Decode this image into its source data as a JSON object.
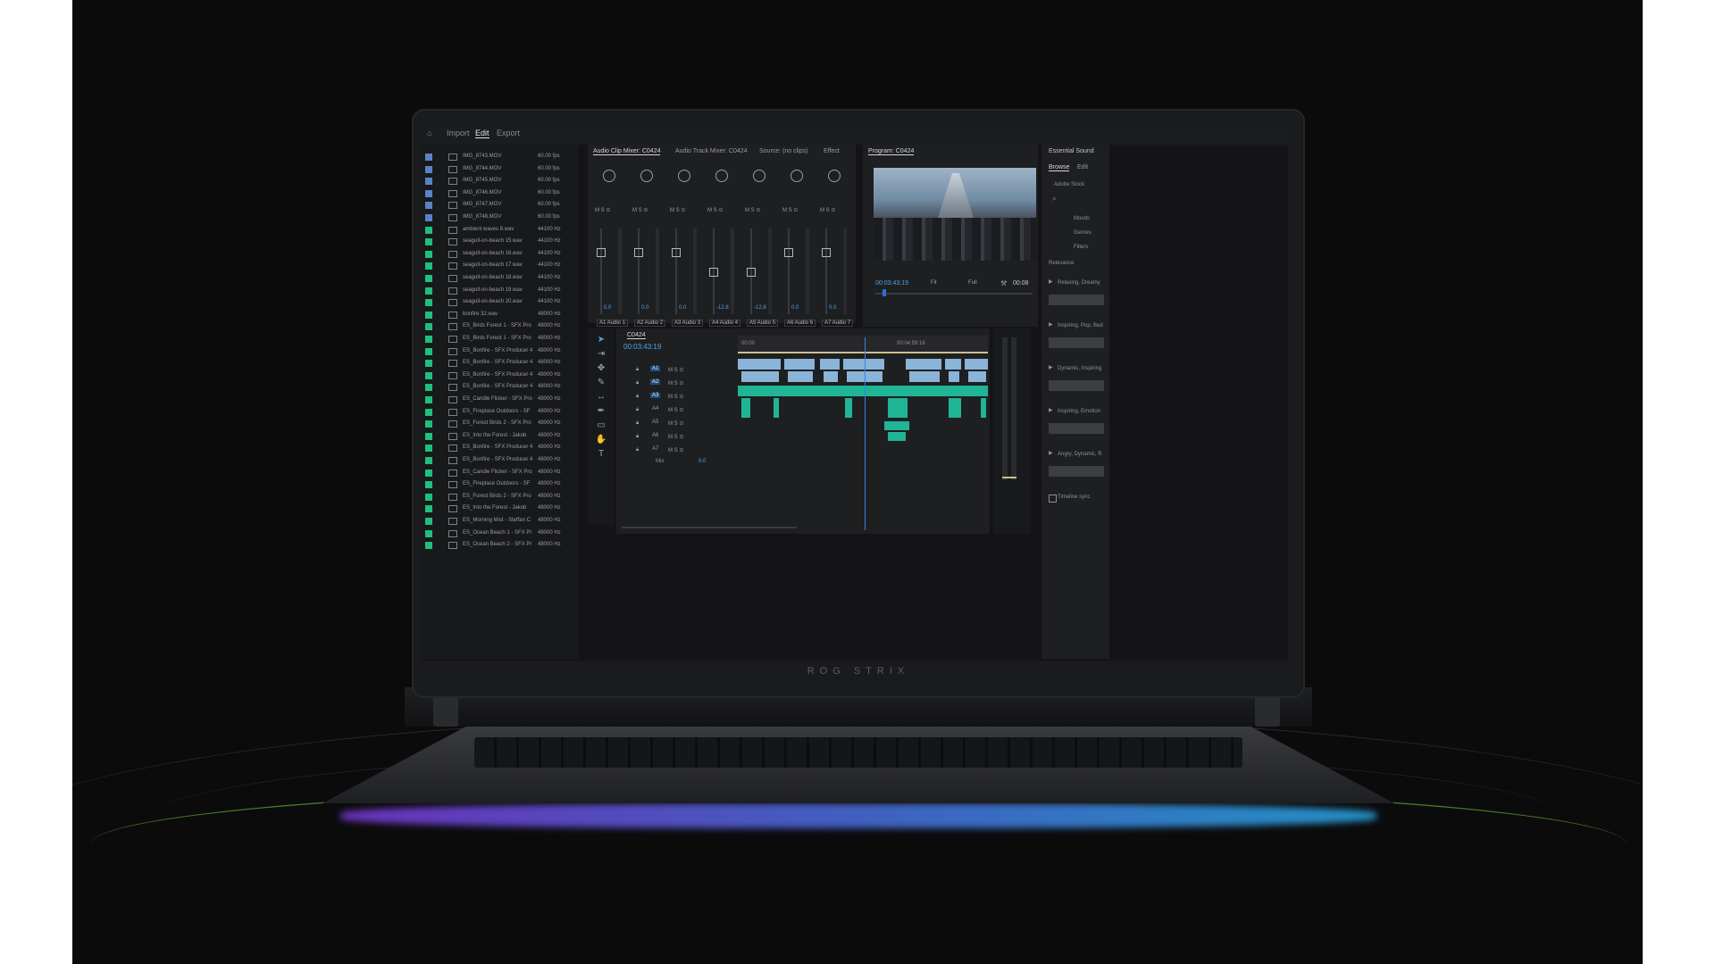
{
  "topbar": {
    "tabs": [
      "Import",
      "Edit",
      "Export"
    ],
    "active": "Edit"
  },
  "project": {
    "rows": [
      {
        "name": "IMG_8743.MOV",
        "rate": "60.00 fps",
        "color": "#5a83c5"
      },
      {
        "name": "IMG_8744.MOV",
        "rate": "60.00 fps",
        "color": "#5a83c5"
      },
      {
        "name": "IMG_8745.MOV",
        "rate": "60.00 fps",
        "color": "#5a83c5"
      },
      {
        "name": "IMG_8746.MOV",
        "rate": "60.00 fps",
        "color": "#5a83c5"
      },
      {
        "name": "IMG_8747.MOV",
        "rate": "60.00 fps",
        "color": "#5a83c5"
      },
      {
        "name": "IMG_8748.MOV",
        "rate": "60.00 fps",
        "color": "#5a83c5"
      },
      {
        "name": "ambient waves 8.wav",
        "rate": "44100 Hz",
        "color": "#1fbf7d"
      },
      {
        "name": "seagull-on-beach 15.wav",
        "rate": "44100 Hz",
        "color": "#1fbf7d"
      },
      {
        "name": "seagull-on-beach 16.wav",
        "rate": "44100 Hz",
        "color": "#1fbf7d"
      },
      {
        "name": "seagull-on-beach 17.wav",
        "rate": "44100 Hz",
        "color": "#1fbf7d"
      },
      {
        "name": "seagull-on-beach 18.wav",
        "rate": "44100 Hz",
        "color": "#1fbf7d"
      },
      {
        "name": "seagull-on-beach 19.wav",
        "rate": "44100 Hz",
        "color": "#1fbf7d"
      },
      {
        "name": "seagull-on-beach 20.wav",
        "rate": "44100 Hz",
        "color": "#1fbf7d"
      },
      {
        "name": "bonfire 32.wav",
        "rate": "48000 Hz",
        "color": "#1fbf7d"
      },
      {
        "name": "ES_Birds Forest 1 - SFX Pro",
        "rate": "48000 Hz",
        "color": "#1fbf7d"
      },
      {
        "name": "ES_Birds Forest 1 - SFX Pro",
        "rate": "48000 Hz",
        "color": "#1fbf7d"
      },
      {
        "name": "ES_Bonfire - SFX Producer 4",
        "rate": "48000 Hz",
        "color": "#1fbf7d"
      },
      {
        "name": "ES_Bonfire - SFX Producer 4",
        "rate": "48000 Hz",
        "color": "#1fbf7d"
      },
      {
        "name": "ES_Bonfire - SFX Producer 4",
        "rate": "48000 Hz",
        "color": "#1fbf7d"
      },
      {
        "name": "ES_Bonfire - SFX Producer 4",
        "rate": "48000 Hz",
        "color": "#1fbf7d"
      },
      {
        "name": "ES_Candle Flicker - SFX Pro",
        "rate": "48000 Hz",
        "color": "#1fbf7d"
      },
      {
        "name": "ES_Fireplace Outdoors - SF",
        "rate": "48000 Hz",
        "color": "#1fbf7d"
      },
      {
        "name": "ES_Forest Birds 2 - SFX Pro",
        "rate": "48000 Hz",
        "color": "#1fbf7d"
      },
      {
        "name": "ES_Into the Forest - Jakob",
        "rate": "48000 Hz",
        "color": "#1fbf7d"
      },
      {
        "name": "ES_Bonfire - SFX Producer 4",
        "rate": "48000 Hz",
        "color": "#1fbf7d"
      },
      {
        "name": "ES_Bonfire - SFX Producer 4",
        "rate": "48000 Hz",
        "color": "#1fbf7d"
      },
      {
        "name": "ES_Candle Flicker - SFX Pro",
        "rate": "48000 Hz",
        "color": "#1fbf7d"
      },
      {
        "name": "ES_Fireplace Outdoors - SF",
        "rate": "48000 Hz",
        "color": "#1fbf7d"
      },
      {
        "name": "ES_Forest Birds 2 - SFX Pro",
        "rate": "48000 Hz",
        "color": "#1fbf7d"
      },
      {
        "name": "ES_Into the Forest - Jakob",
        "rate": "48000 Hz",
        "color": "#1fbf7d"
      },
      {
        "name": "ES_Morning Mist - Steffan C",
        "rate": "48000 Hz",
        "color": "#1fbf7d"
      },
      {
        "name": "ES_Ocean Beach 1 - SFX Pr",
        "rate": "48000 Hz",
        "color": "#1fbf7d"
      },
      {
        "name": "ES_Ocean Beach 2 - SFX Pr",
        "rate": "48000 Hz",
        "color": "#1fbf7d"
      }
    ]
  },
  "mixer": {
    "tabs": [
      "Audio Clip Mixer: C0424",
      "Audio Track Mixer: C0424",
      "Source: (no clips)",
      "Effect"
    ],
    "channels": [
      {
        "track": "A1",
        "name": "Audio 1",
        "value": "0.0"
      },
      {
        "track": "A2",
        "name": "Audio 2",
        "value": "0.0"
      },
      {
        "track": "A3",
        "name": "Audio 3",
        "value": "0.0"
      },
      {
        "track": "A4",
        "name": "Audio 4",
        "value": "-12.8"
      },
      {
        "track": "A5",
        "name": "Audio 5",
        "value": "-12.8"
      },
      {
        "track": "A6",
        "name": "Audio 6",
        "value": "0.0"
      },
      {
        "track": "A7",
        "name": "Audio 7",
        "value": "0.0"
      }
    ],
    "msb": "M S ⊙"
  },
  "program": {
    "title": "Program: C0424",
    "timecode": "00:03:43:19",
    "fit": "Fit",
    "quality": "Full",
    "end": "00:08"
  },
  "timeline": {
    "tab": "C0424",
    "timecode": "00:03:43:19",
    "ruler": [
      "00:00",
      "00:04:59:16"
    ],
    "tracks": [
      "A1",
      "A2",
      "A3",
      "A4",
      "A5",
      "A6",
      "A7"
    ],
    "mix": "Mix",
    "mix_value": "0.0"
  },
  "essential_sound": {
    "title": "Essential Sound",
    "tabs": [
      "Browse",
      "Edit"
    ],
    "stock": "Adobe Stock",
    "filters": [
      "Moods",
      "Genres",
      "Filters"
    ],
    "sort": "Relevance",
    "results": [
      "Relaxing, Dreamy",
      "Inspiring, Pop, Bed",
      "Dynamic, Inspiring",
      "Inspiring, Emotion",
      "Angry, Dynamic, R"
    ],
    "checkbox": "Timeline sync"
  },
  "laptop": {
    "brand": "ROG STRIX"
  }
}
